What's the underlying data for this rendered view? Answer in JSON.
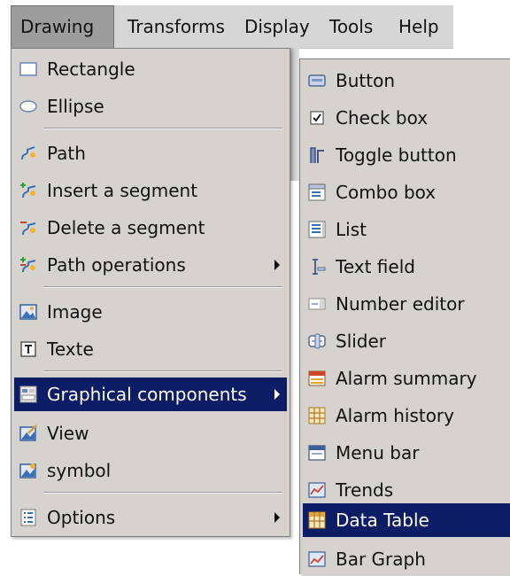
{
  "menubar": {
    "items": [
      {
        "label": "Drawing"
      },
      {
        "label": "Transforms"
      },
      {
        "label": "Display"
      },
      {
        "label": "Tools"
      },
      {
        "label": "Help"
      }
    ]
  },
  "drawing_menu": {
    "items": [
      {
        "label": "Rectangle",
        "icon": "rectangle-icon"
      },
      {
        "label": "Ellipse",
        "icon": "ellipse-icon"
      },
      {
        "label": "Path",
        "icon": "path-icon"
      },
      {
        "label": "Insert a segment",
        "icon": "insert-segment-icon"
      },
      {
        "label": "Delete a segment",
        "icon": "delete-segment-icon"
      },
      {
        "label": "Path operations",
        "icon": "path-operations-icon"
      },
      {
        "label": "Image",
        "icon": "image-icon"
      },
      {
        "label": "Texte",
        "icon": "text-icon"
      },
      {
        "label": "Graphical components",
        "icon": "graphical-components-icon"
      },
      {
        "label": "View",
        "icon": "view-icon"
      },
      {
        "label": "symbol",
        "icon": "symbol-icon"
      },
      {
        "label": "Options",
        "icon": "options-icon"
      }
    ]
  },
  "components_menu": {
    "items": [
      {
        "label": "Button",
        "icon": "button-icon"
      },
      {
        "label": "Check box",
        "icon": "checkbox-icon"
      },
      {
        "label": "Toggle button",
        "icon": "toggle-button-icon"
      },
      {
        "label": "Combo box",
        "icon": "combo-box-icon"
      },
      {
        "label": "List",
        "icon": "list-icon"
      },
      {
        "label": "Text field",
        "icon": "text-field-icon"
      },
      {
        "label": "Number editor",
        "icon": "number-editor-icon"
      },
      {
        "label": "Slider",
        "icon": "slider-icon"
      },
      {
        "label": "Alarm summary",
        "icon": "alarm-summary-icon"
      },
      {
        "label": "Alarm history",
        "icon": "alarm-history-icon"
      },
      {
        "label": "Menu bar",
        "icon": "menu-bar-icon"
      },
      {
        "label": "Trends",
        "icon": "trends-icon"
      },
      {
        "label": "Data Table",
        "icon": "data-table-icon"
      },
      {
        "label": "Bar Graph",
        "icon": "bar-graph-icon"
      }
    ]
  },
  "colors": {
    "menu_background": "#d6d3ce",
    "selection": "#0c1d66",
    "menubar_open": "#9d9d9d"
  }
}
